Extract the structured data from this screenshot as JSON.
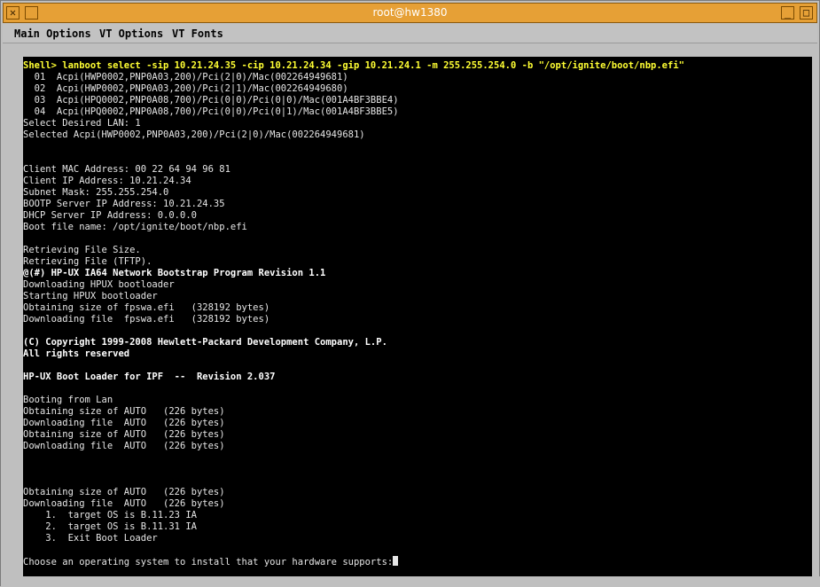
{
  "window": {
    "title": "root@hw1380",
    "buttons": {
      "close": "✕",
      "minimize": "_",
      "maximize": "□"
    }
  },
  "menubar": {
    "items": [
      "Main Options",
      "VT Options",
      "VT Fonts"
    ]
  },
  "terminal": {
    "lines": [
      {
        "text": "Shell> lanboot select -sip 10.21.24.35 -cip 10.21.24.34 -gip 10.21.24.1 -m 255.255.254.0 -b \"/opt/ignite/boot/nbp.efi\"",
        "style": "yellow"
      },
      {
        "text": "  01  Acpi(HWP0002,PNP0A03,200)/Pci(2|0)/Mac(002264949681)",
        "style": "normal"
      },
      {
        "text": "  02  Acpi(HWP0002,PNP0A03,200)/Pci(2|1)/Mac(002264949680)",
        "style": "normal"
      },
      {
        "text": "  03  Acpi(HPQ0002,PNP0A08,700)/Pci(0|0)/Pci(0|0)/Mac(001A4BF3BBE4)",
        "style": "normal"
      },
      {
        "text": "  04  Acpi(HPQ0002,PNP0A08,700)/Pci(0|0)/Pci(0|1)/Mac(001A4BF3BBE5)",
        "style": "normal"
      },
      {
        "text": "Select Desired LAN: 1",
        "style": "normal"
      },
      {
        "text": "Selected Acpi(HWP0002,PNP0A03,200)/Pci(2|0)/Mac(002264949681)",
        "style": "normal"
      },
      {
        "text": "",
        "style": "normal"
      },
      {
        "text": "",
        "style": "normal"
      },
      {
        "text": "Client MAC Address: 00 22 64 94 96 81",
        "style": "normal"
      },
      {
        "text": "Client IP Address: 10.21.24.34",
        "style": "normal"
      },
      {
        "text": "Subnet Mask: 255.255.254.0",
        "style": "normal"
      },
      {
        "text": "BOOTP Server IP Address: 10.21.24.35",
        "style": "normal"
      },
      {
        "text": "DHCP Server IP Address: 0.0.0.0",
        "style": "normal"
      },
      {
        "text": "Boot file name: /opt/ignite/boot/nbp.efi",
        "style": "normal"
      },
      {
        "text": "",
        "style": "normal"
      },
      {
        "text": "Retrieving File Size.",
        "style": "normal"
      },
      {
        "text": "Retrieving File (TFTP).",
        "style": "normal"
      },
      {
        "text": "@(#) HP-UX IA64 Network Bootstrap Program Revision 1.1",
        "style": "bright"
      },
      {
        "text": "Downloading HPUX bootloader",
        "style": "normal"
      },
      {
        "text": "Starting HPUX bootloader",
        "style": "normal"
      },
      {
        "text": "Obtaining size of fpswa.efi   (328192 bytes)",
        "style": "normal"
      },
      {
        "text": "Downloading file  fpswa.efi   (328192 bytes)",
        "style": "normal"
      },
      {
        "text": "",
        "style": "normal"
      },
      {
        "text": "(C) Copyright 1999-2008 Hewlett-Packard Development Company, L.P.",
        "style": "bright"
      },
      {
        "text": "All rights reserved",
        "style": "bright"
      },
      {
        "text": "",
        "style": "normal"
      },
      {
        "text": "HP-UX Boot Loader for IPF  --  Revision 2.037",
        "style": "bright"
      },
      {
        "text": "",
        "style": "normal"
      },
      {
        "text": "Booting from Lan",
        "style": "normal"
      },
      {
        "text": "Obtaining size of AUTO   (226 bytes)",
        "style": "normal"
      },
      {
        "text": "Downloading file  AUTO   (226 bytes)",
        "style": "normal"
      },
      {
        "text": "Obtaining size of AUTO   (226 bytes)",
        "style": "normal"
      },
      {
        "text": "Downloading file  AUTO   (226 bytes)",
        "style": "normal"
      },
      {
        "text": "",
        "style": "normal"
      },
      {
        "text": "",
        "style": "normal"
      },
      {
        "text": "",
        "style": "normal"
      },
      {
        "text": "Obtaining size of AUTO   (226 bytes)",
        "style": "normal"
      },
      {
        "text": "Downloading file  AUTO   (226 bytes)",
        "style": "normal"
      },
      {
        "text": "    1.  target OS is B.11.23 IA",
        "style": "normal"
      },
      {
        "text": "    2.  target OS is B.11.31 IA",
        "style": "normal"
      },
      {
        "text": "    3.  Exit Boot Loader",
        "style": "normal"
      },
      {
        "text": "",
        "style": "normal"
      },
      {
        "text": "Choose an operating system to install that your hardware supports:",
        "style": "prompt"
      }
    ]
  },
  "colors": {
    "titlebar": "#e6a036",
    "terminal_bg": "#000000",
    "terminal_fg": "#e6e6e6",
    "command": "#ffff33"
  }
}
